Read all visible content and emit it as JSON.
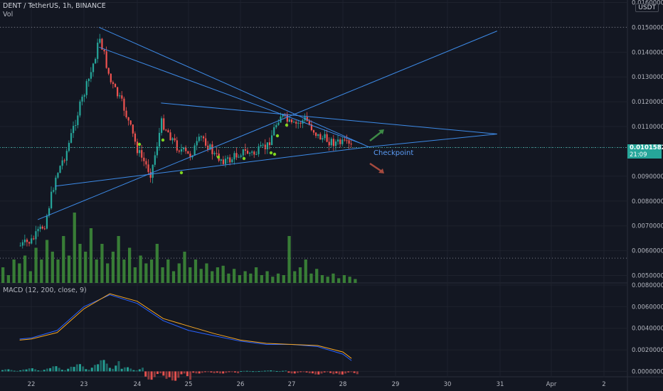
{
  "header": {
    "symbol": "DENT / TetherUS, 1h, BINANCE",
    "vol_label": "Vol",
    "macd_label": "MACD (12, 200, close, 9)",
    "currency": "USDT"
  },
  "price_tag": {
    "price": "0.0101582",
    "countdown": "21:09",
    "color": "#26a69a"
  },
  "annotations": {
    "checkpoint": "Checkpoint"
  },
  "colors": {
    "background": "#131722",
    "up": "#26a69a",
    "down": "#ef5350",
    "trendline": "#3d8be8",
    "macd": "#2962ff",
    "signal": "#f5a623",
    "grid": "#1e222d"
  },
  "chart_data": [
    {
      "type": "candlestick",
      "title": "DENT / TetherUS, 1h, BINANCE",
      "y_range": [
        0.0047,
        0.0161
      ],
      "y_ticks": [
        "0.0160000",
        "0.0150000",
        "0.0140000",
        "0.0130000",
        "0.0120000",
        "0.0110000",
        "0.0090000",
        "0.0080000",
        "0.0070000",
        "0.0060000",
        "0.0050000"
      ],
      "x_ticks": [
        "22",
        "23",
        "24",
        "25",
        "26",
        "27",
        "28",
        "29",
        "30",
        "31",
        "Apr",
        "2"
      ],
      "close_path": [
        {
          "date": "21 19:00",
          "price": 0.0062
        },
        {
          "date": "22 00:00",
          "price": 0.0064
        },
        {
          "date": "22 06:00",
          "price": 0.0071
        },
        {
          "date": "22 11:00",
          "price": 0.009
        },
        {
          "date": "22 16:00",
          "price": 0.01
        },
        {
          "date": "22 21:00",
          "price": 0.0115
        },
        {
          "date": "23 03:00",
          "price": 0.0132
        },
        {
          "date": "23 07:00",
          "price": 0.0146
        },
        {
          "date": "23 12:00",
          "price": 0.0128
        },
        {
          "date": "23 18:00",
          "price": 0.0118
        },
        {
          "date": "24 00:00",
          "price": 0.01
        },
        {
          "date": "24 06:00",
          "price": 0.0091
        },
        {
          "date": "24 11:00",
          "price": 0.0112
        },
        {
          "date": "24 18:00",
          "price": 0.0102
        },
        {
          "date": "25 00:00",
          "price": 0.0098
        },
        {
          "date": "25 06:00",
          "price": 0.0106
        },
        {
          "date": "25 12:00",
          "price": 0.0098
        },
        {
          "date": "25 18:00",
          "price": 0.0096
        },
        {
          "date": "26 00:00",
          "price": 0.01
        },
        {
          "date": "26 06:00",
          "price": 0.0099
        },
        {
          "date": "26 12:00",
          "price": 0.0102
        },
        {
          "date": "26 18:00",
          "price": 0.0115
        },
        {
          "date": "27 00:00",
          "price": 0.011
        },
        {
          "date": "27 06:00",
          "price": 0.0113
        },
        {
          "date": "27 12:00",
          "price": 0.0106
        },
        {
          "date": "27 18:00",
          "price": 0.0104
        },
        {
          "date": "28 00:00",
          "price": 0.0103
        },
        {
          "date": "28 04:00",
          "price": 0.01016
        }
      ],
      "last_price": 0.0101582,
      "trendlines": [
        {
          "from": {
            "date": "23 07:00",
            "price": 0.015
          },
          "to": {
            "date": "28 12:00",
            "price": 0.01018
          }
        },
        {
          "from": {
            "date": "23 07:00",
            "price": 0.0142
          },
          "to": {
            "date": "28 09:00",
            "price": 0.0103
          }
        },
        {
          "from": {
            "date": "22 03:00",
            "price": 0.00725
          },
          "to": {
            "date": "30 23:00",
            "price": 0.01485
          }
        },
        {
          "from": {
            "date": "22 11:00",
            "price": 0.0086
          },
          "to": {
            "date": "28 12:00",
            "price": 0.01018
          }
        },
        {
          "from": {
            "date": "24 11:00",
            "price": 0.01195
          },
          "to": {
            "date": "30 23:00",
            "price": 0.0107
          }
        },
        {
          "from": {
            "date": "28 12:00",
            "price": 0.01018
          },
          "to": {
            "date": "30 23:00",
            "price": 0.0107
          }
        }
      ],
      "reference_levels": [
        0.015,
        0.0101582,
        0.0057
      ]
    },
    {
      "type": "bar",
      "title": "Vol",
      "series": [
        {
          "values": [
            0.2,
            0.1,
            0.3,
            0.25,
            0.35,
            0.15,
            0.45,
            0.3,
            0.55,
            0.4,
            0.3,
            0.6,
            0.35,
            0.9,
            0.5,
            0.4,
            0.7,
            0.3,
            0.5,
            0.25,
            0.4,
            0.6,
            0.3,
            0.45,
            0.2,
            0.35,
            0.25,
            0.3,
            0.5,
            0.2,
            0.3,
            0.15,
            0.25,
            0.4,
            0.2,
            0.3,
            0.18,
            0.25,
            0.15,
            0.2,
            0.22,
            0.12,
            0.18,
            0.1,
            0.15,
            0.12,
            0.2,
            0.1,
            0.15,
            0.08,
            0.12,
            0.1,
            0.6,
            0.15,
            0.2,
            0.3,
            0.12,
            0.18,
            0.1,
            0.08,
            0.12,
            0.06,
            0.1,
            0.08,
            0.05
          ]
        }
      ]
    },
    {
      "type": "line",
      "title": "MACD (12, 200, close, 9)",
      "y_range": [
        -0.0005,
        0.0082
      ],
      "y_ticks": [
        "0.0080000",
        "0.0060000",
        "0.0040000",
        "0.0020000",
        "0.0000000"
      ],
      "x": [
        "21 19:00",
        "22 00:00",
        "22 12:00",
        "23 00:00",
        "23 12:00",
        "24 00:00",
        "24 12:00",
        "25 00:00",
        "25 12:00",
        "26 00:00",
        "26 12:00",
        "27 00:00",
        "27 12:00",
        "28 00:00",
        "28 04:00"
      ],
      "series": [
        {
          "name": "MACD",
          "values": [
            0.003,
            0.0031,
            0.0038,
            0.006,
            0.0071,
            0.0063,
            0.0047,
            0.0038,
            0.0033,
            0.0028,
            0.0025,
            0.0025,
            0.0023,
            0.0016,
            0.001
          ]
        },
        {
          "name": "Signal",
          "values": [
            0.0029,
            0.003,
            0.0036,
            0.0058,
            0.0072,
            0.0065,
            0.0049,
            0.0042,
            0.0035,
            0.0029,
            0.0026,
            0.0025,
            0.0024,
            0.0018,
            0.0012
          ]
        }
      ],
      "histogram": [
        0.0002,
        0.0003,
        0.0005,
        0.0007,
        0.0011,
        0.0004,
        -0.0008,
        -0.0009,
        -0.0002,
        -0.0002,
        5e-05,
        0.0001,
        -0.0002,
        -0.0003,
        -0.0003
      ]
    }
  ]
}
